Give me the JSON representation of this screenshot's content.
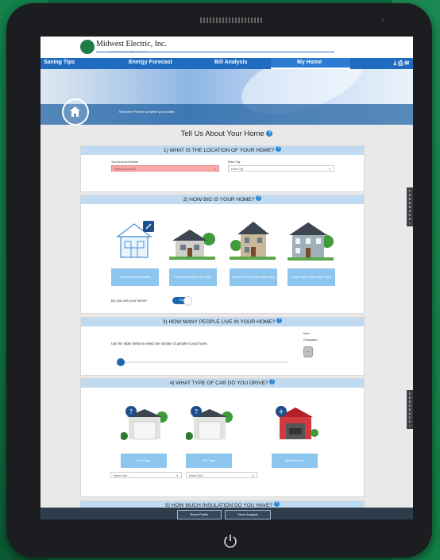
{
  "header": {
    "company": "Midwest Electric, Inc.",
    "tagline": "A Touchstone Energy® Cooperative"
  },
  "nav": {
    "tabs": [
      {
        "label": "Saving Tips"
      },
      {
        "label": "Energy Forecast"
      },
      {
        "label": "Bill Analysis"
      },
      {
        "label": "My Home"
      }
    ],
    "active_tab": "My Home"
  },
  "hero": {
    "message": "Welcome! Please complete your profile."
  },
  "page": {
    "title": "Tell Us About Your Home"
  },
  "sections": {
    "location": {
      "title": "1) WHAT IS THE LOCATION OF YOUR HOME?",
      "account_label": "Your Account Number",
      "account_placeholder": "Enter Account No.",
      "city_label": "Enter City",
      "city_value": "Enter City"
    },
    "size": {
      "title": "2) HOW BIG IS YOUR HOME?",
      "options": [
        {
          "label": "Advanced House Details"
        },
        {
          "label": "Small House (500-1500 Sqft.)"
        },
        {
          "label": "Medium House (1500-3500 Sqft.)"
        },
        {
          "label": "Large House (3500-5000 Sqft.)"
        }
      ],
      "own_label": "Do you own your home?",
      "own_value": "Yes"
    },
    "people": {
      "title": "3) HOW MANY PEOPLE LIVE IN YOUR HOME?",
      "slider_label": "Use the slider below to select the number of people in your home.",
      "num_label_1": "Num.",
      "num_label_2": "Occupants:",
      "num_value": "-"
    },
    "car": {
      "title": "4) WHAT TYPE OF CAR DO YOU DRIVE?",
      "car1_label": "Car 1 Type:",
      "car2_label": "Car 2 Type:",
      "add_label": "Add More Cars",
      "select_placeholder": "Select One..."
    },
    "insulation": {
      "title": "5) HOW MUCH INSULATION DO YOU HAVE?"
    }
  },
  "footer": {
    "reset_label": "Reset Profile",
    "analysis_label": "Show Analysis"
  },
  "feedback": {
    "label": "FEEDBACK"
  },
  "colors": {
    "nav": "#1f6bbf",
    "section_header": "#bfdaf1",
    "button": "#8cc6ee",
    "error_field": "#f6aaa9"
  }
}
